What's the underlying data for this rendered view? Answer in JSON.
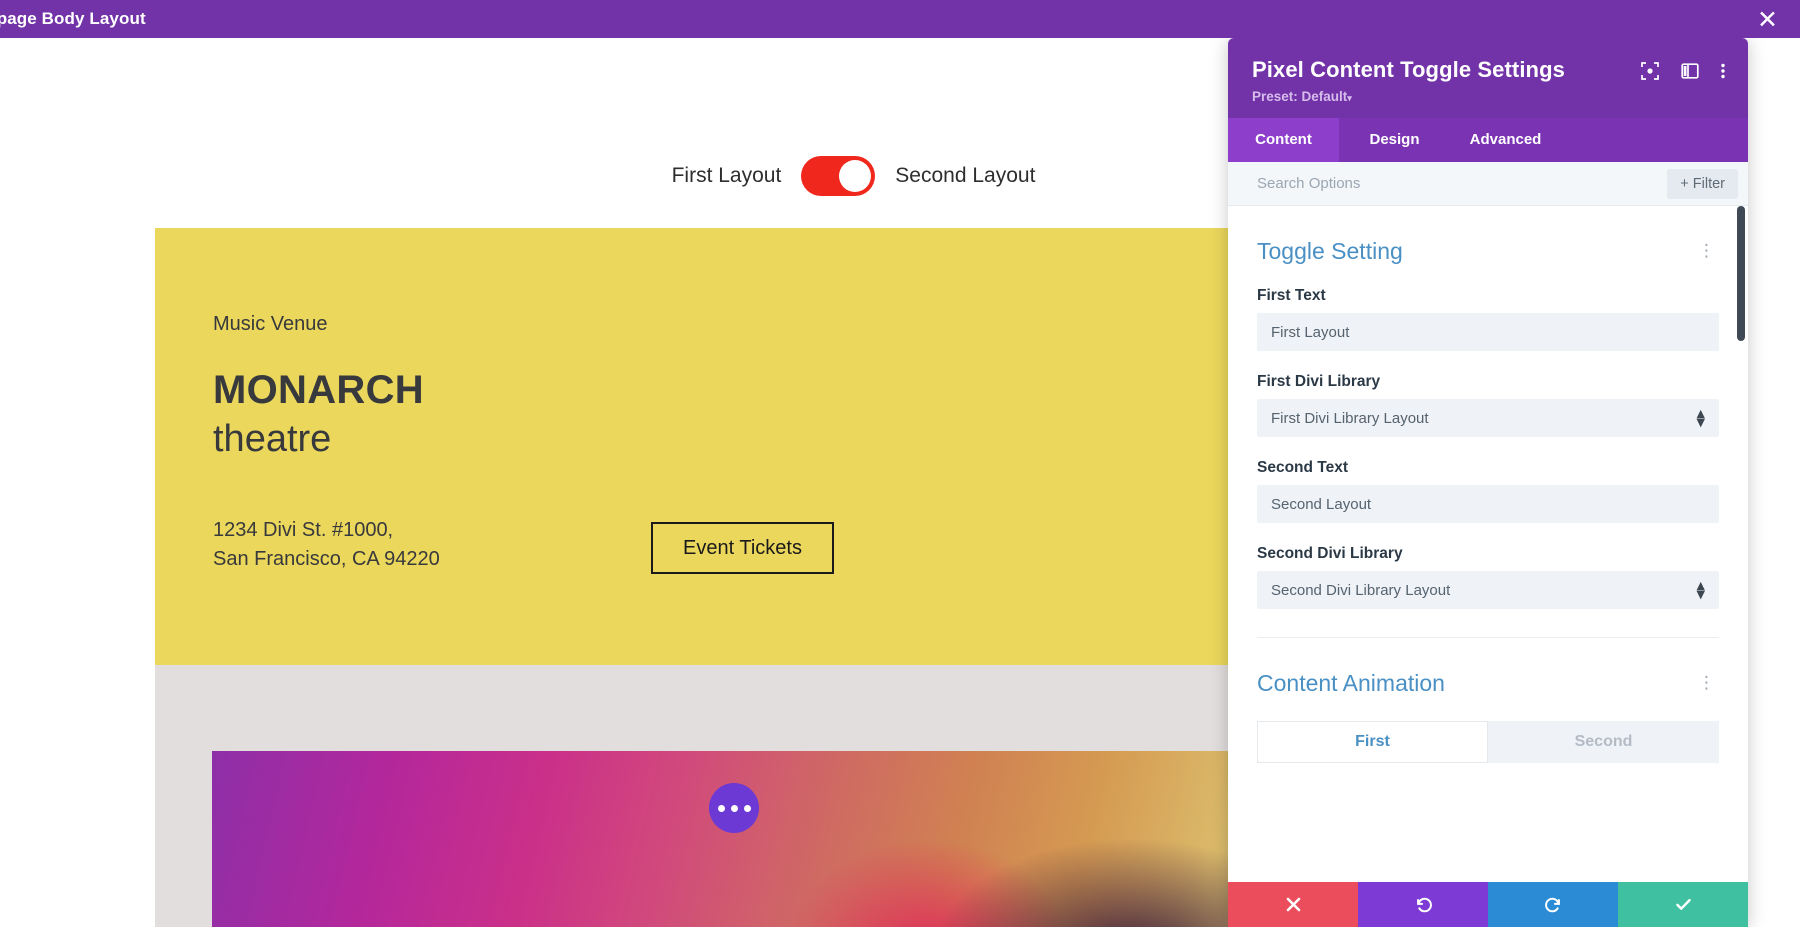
{
  "topbar": {
    "title": "mepage Body Layout",
    "close_icon": "close-icon"
  },
  "canvas": {
    "toggle": {
      "first_label": "First Layout",
      "second_label": "Second Layout",
      "state": "second",
      "track_color": "#f0271d",
      "knob_color": "#ffffff"
    },
    "hero": {
      "background_color": "#ebd75c",
      "eyebrow": "Music Venue",
      "title_line1": "MONARCH",
      "title_line2": "theatre",
      "address_line1": "1234 Divi St. #1000,",
      "address_line2": "San Francisco, CA 94220",
      "cta_label": "Event Tickets"
    },
    "grey_band_color": "#e2dedd",
    "photo": {
      "overlay_button_icon": "three-dots-icon",
      "overlay_button_color": "#6c39d4"
    }
  },
  "panel": {
    "title": "Pixel Content Toggle Settings",
    "preset_label": "Preset: Default",
    "preset_caret": "▾",
    "header_color": "#7232a8",
    "header_icons": [
      {
        "name": "focus-view-icon"
      },
      {
        "name": "split-panel-icon"
      },
      {
        "name": "kebab-menu-icon"
      }
    ],
    "tabs": [
      {
        "label": "Content",
        "active": true
      },
      {
        "label": "Design",
        "active": false
      },
      {
        "label": "Advanced",
        "active": false
      }
    ],
    "search": {
      "value": "",
      "placeholder": "Search Options",
      "filter_label": "+ Filter"
    },
    "sections": [
      {
        "title": "Toggle Setting",
        "kebab": "⋮",
        "fields": [
          {
            "label": "First Text",
            "type": "input",
            "value": "First Layout"
          },
          {
            "label": "First Divi Library",
            "type": "select",
            "value": "First Divi Library Layout"
          },
          {
            "label": "Second Text",
            "type": "input",
            "value": "Second Layout"
          },
          {
            "label": "Second Divi Library",
            "type": "select",
            "value": "Second Divi Library Layout"
          }
        ]
      },
      {
        "title": "Content Animation",
        "kebab": "⋮",
        "toggle_buttons": [
          {
            "label": "First",
            "active": true
          },
          {
            "label": "Second",
            "active": false
          }
        ]
      }
    ],
    "footer": [
      {
        "name": "cancel-button",
        "icon": "close-icon",
        "color": "#eb4d5c"
      },
      {
        "name": "undo-button",
        "icon": "undo-icon",
        "color": "#7d3ad4"
      },
      {
        "name": "redo-button",
        "icon": "redo-icon",
        "color": "#2b8bd4"
      },
      {
        "name": "save-button",
        "icon": "check-icon",
        "color": "#3fc0a0"
      }
    ],
    "scrollbar_color": "#3f4a56"
  }
}
